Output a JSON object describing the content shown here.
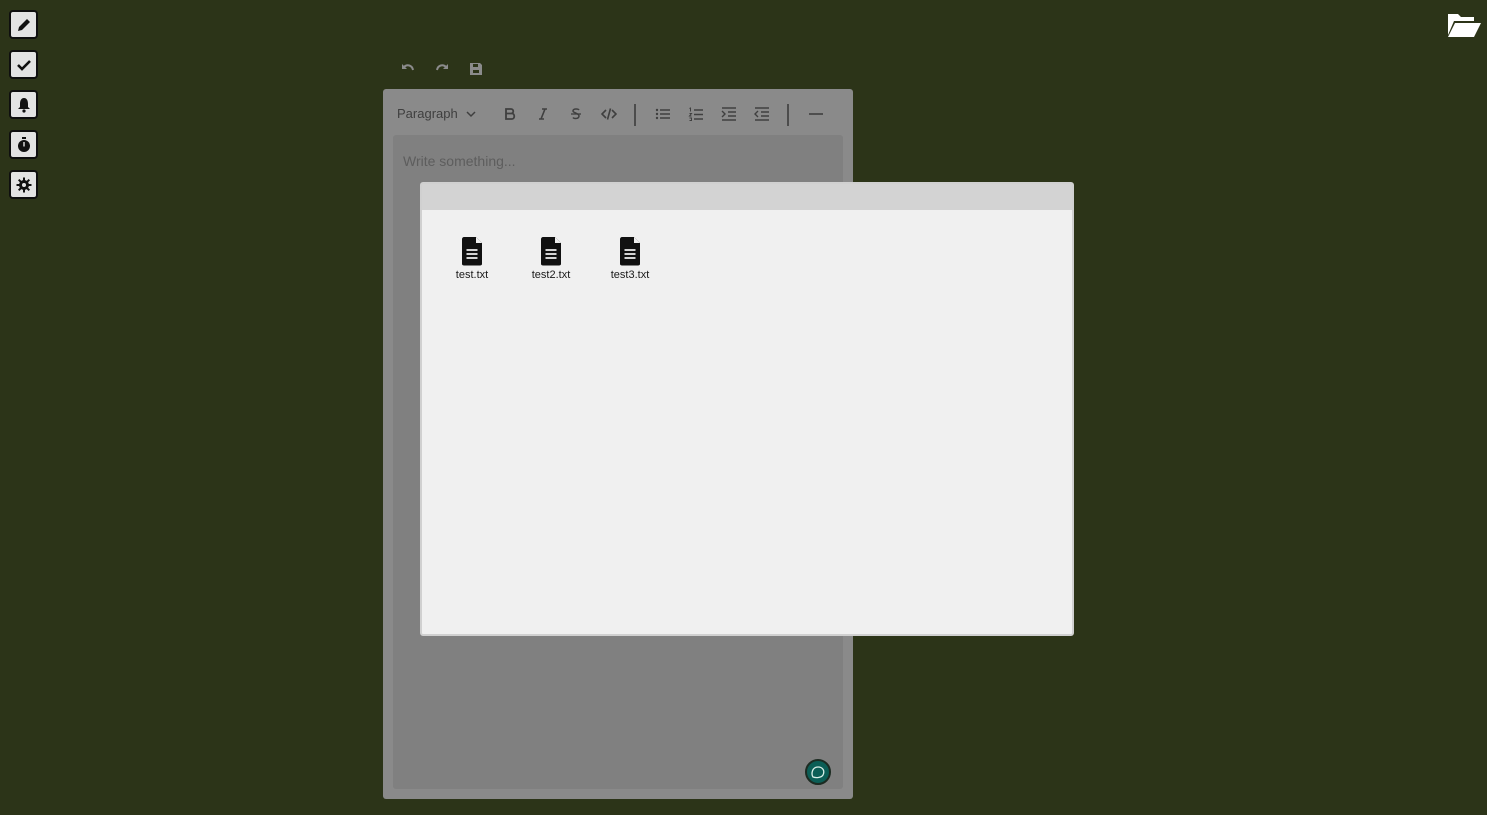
{
  "rail": {
    "items": [
      {
        "name": "pencil-icon",
        "label": "Edit"
      },
      {
        "name": "check-icon",
        "label": "Tasks"
      },
      {
        "name": "bell-icon",
        "label": "Reminders"
      },
      {
        "name": "stopwatch-icon",
        "label": "Timer"
      },
      {
        "name": "gear-icon",
        "label": "Settings"
      }
    ]
  },
  "editor": {
    "block_type": "Paragraph",
    "placeholder": "Write something..."
  },
  "file_dialog": {
    "files": [
      {
        "name": "test.txt"
      },
      {
        "name": "test2.txt"
      },
      {
        "name": "test3.txt"
      }
    ]
  },
  "colors": {
    "background": "#2c3418",
    "editor_panel": "#8a8a8a",
    "dialog_body": "#f0f0f0",
    "dialog_title": "#d3d3d3",
    "chat_badge": "#0b5e56"
  }
}
